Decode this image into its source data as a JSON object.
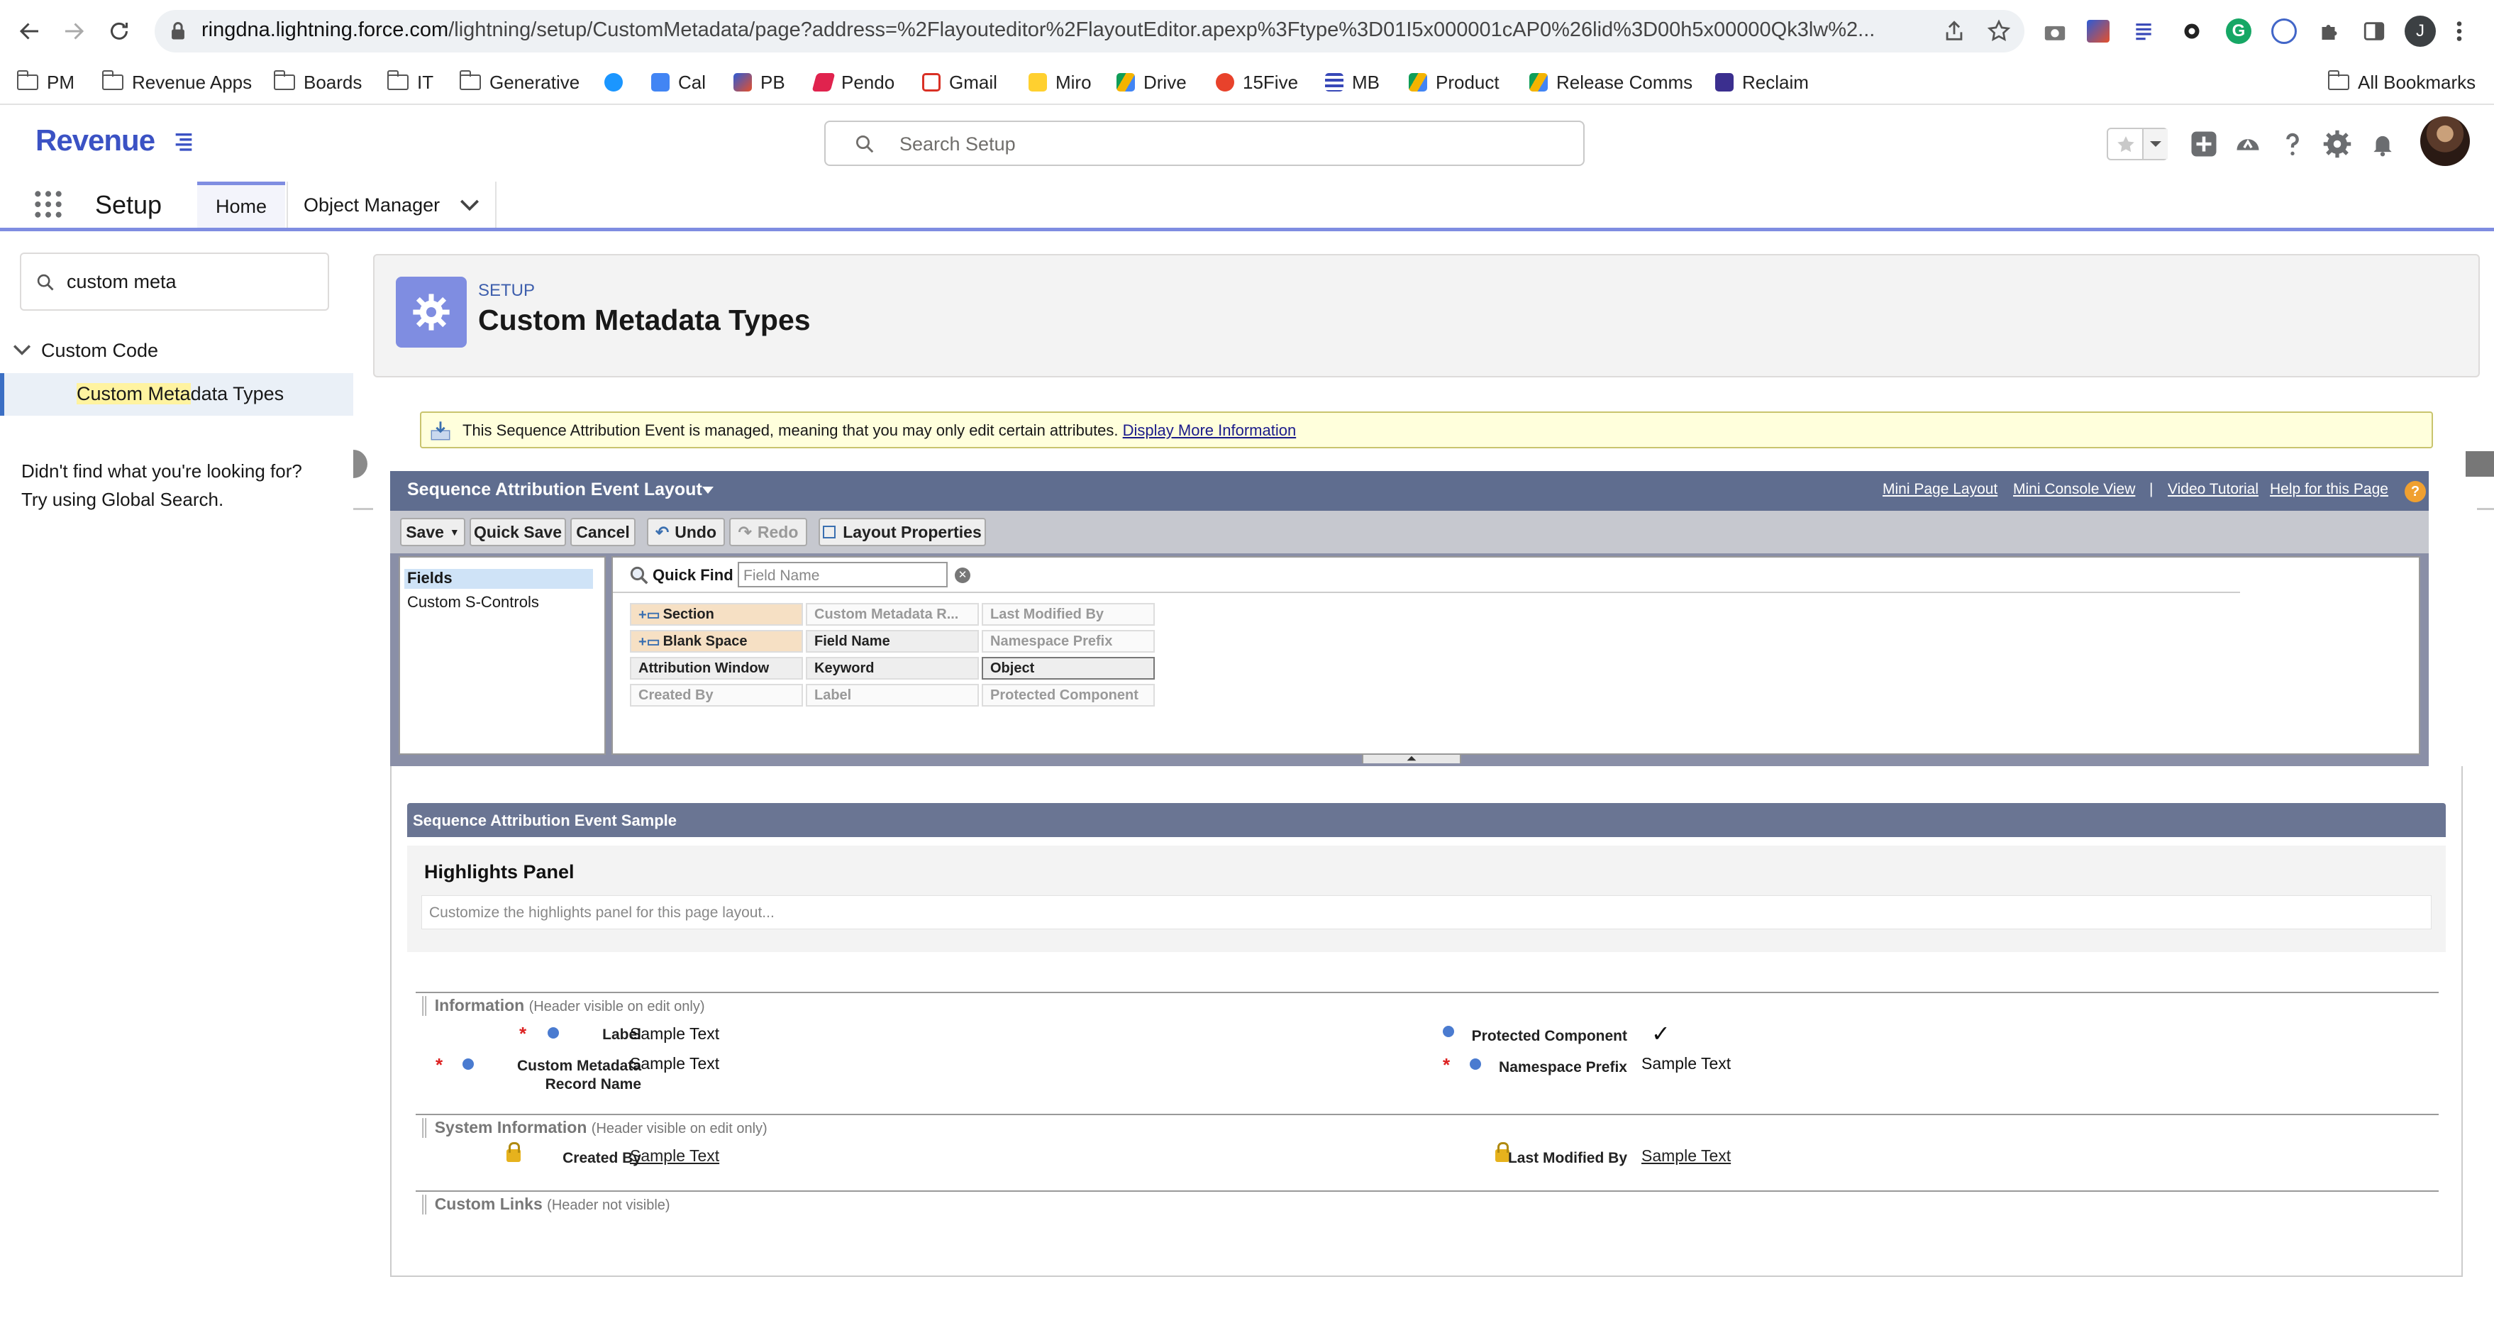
{
  "browser": {
    "url_host": "ringdna.lightning.force.com",
    "url_path": "/lightning/setup/CustomMetadata/page?address=%2Flayouteditor%2FlayoutEditor.apexp%3Ftype%3D01I5x000001cAP0%26lid%3D00h5x00000Qk3lw%2...",
    "profile_initial": "J",
    "bookmarks": [
      "PM",
      "Revenue Apps",
      "Boards",
      "IT",
      "Generative",
      "Cal",
      "PB",
      "Pendo",
      "Gmail",
      "Miro",
      "Drive",
      "15Five",
      "MB",
      "Product",
      "Release Comms",
      "Reclaim"
    ],
    "all_bookmarks": "All Bookmarks"
  },
  "sf": {
    "logo": "Revenue",
    "search_placeholder": "Search Setup",
    "app_name": "Setup",
    "tabs": {
      "home": "Home",
      "object_manager": "Object Manager"
    }
  },
  "sidebar": {
    "search_value": "custom meta",
    "section": "Custom Code",
    "item_pre": "Custom ",
    "item_highlight": "Meta",
    "item_post": "data Types",
    "help_line1": "Didn't find what you're looking for?",
    "help_line2": "Try using Global Search."
  },
  "page": {
    "eyebrow": "SETUP",
    "title": "Custom Metadata Types"
  },
  "message": {
    "text": "This Sequence Attribution Event is managed, meaning that you may only edit certain attributes.",
    "link": "Display More Information"
  },
  "layout_editor": {
    "title": "Sequence Attribution Event Layout",
    "links": [
      "Mini Page Layout",
      "Mini Console View",
      "Video Tutorial",
      "Help for this Page"
    ],
    "link_separator": "|",
    "toolbar": {
      "save": "Save",
      "quick_save": "Quick Save",
      "cancel": "Cancel",
      "undo": "Undo",
      "redo": "Redo",
      "layout_properties": "Layout Properties"
    },
    "palette_categories": [
      "Fields",
      "Custom S-Controls"
    ],
    "quick_find_label": "Quick Find",
    "quick_find_placeholder": "Field Name",
    "palette_fields": [
      [
        "Section",
        "Custom Metadata R...",
        "Last Modified By"
      ],
      [
        "Blank Space",
        "Field Name",
        "Namespace Prefix"
      ],
      [
        "Attribution Window",
        "Keyword",
        "Object"
      ],
      [
        "Created By",
        "Label",
        "Protected Component"
      ]
    ]
  },
  "sample": {
    "header": "Sequence Attribution Event Sample",
    "highlights_title": "Highlights Panel",
    "highlights_hint": "Customize the highlights panel for this page layout...",
    "sections": [
      {
        "title": "Information",
        "note": "(Header visible on edit only)"
      },
      {
        "title": "System Information",
        "note": "(Header visible on edit only)"
      },
      {
        "title": "Custom Links",
        "note": "(Header not visible)"
      }
    ],
    "fields": {
      "label": "Label",
      "label_val": "Sample Text",
      "record_name_1": "Custom Metadata",
      "record_name_2": "Record Name",
      "record_name_val": "Sample Text",
      "protected": "Protected Component",
      "protected_val": "✓",
      "namespace": "Namespace Prefix",
      "namespace_val": "Sample Text",
      "created_by": "Created By",
      "created_by_val": "Sample Text",
      "modified_by": "Last Modified By",
      "modified_by_val": "Sample Text"
    }
  },
  "colors": {
    "brand": "#7f8de1",
    "logo": "#3b52c4",
    "message_bg": "#ffffdc",
    "panel_header": "#5f6d8f"
  }
}
